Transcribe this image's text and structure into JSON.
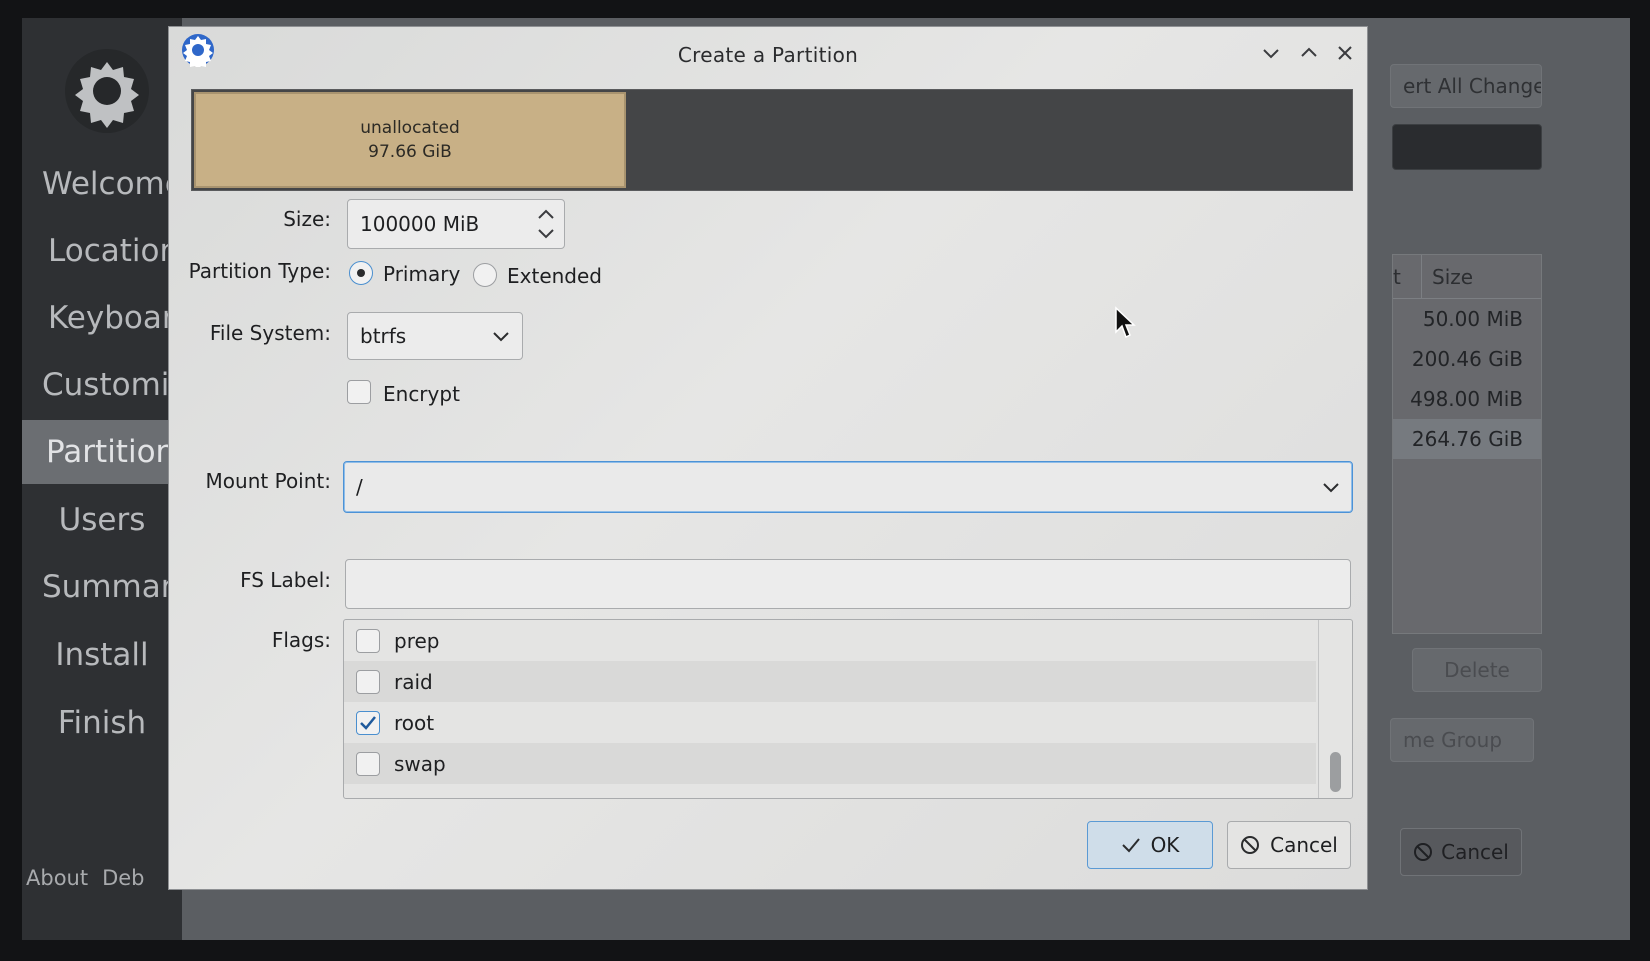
{
  "sidebar": {
    "items": [
      {
        "label": "Welcome"
      },
      {
        "label": "Location"
      },
      {
        "label": "Keyboard"
      },
      {
        "label": "Customize"
      },
      {
        "label": "Partitions"
      },
      {
        "label": "Users"
      },
      {
        "label": "Summary"
      },
      {
        "label": "Install"
      },
      {
        "label": "Finish"
      }
    ],
    "footer": {
      "about": "About",
      "debug": "Deb"
    }
  },
  "background": {
    "revert_label": "ert All Changes",
    "table_header_col1": "t",
    "table_header_col2": "Size",
    "rows": [
      {
        "size": "50.00 MiB"
      },
      {
        "size": "200.46 GiB"
      },
      {
        "size": "498.00 MiB"
      },
      {
        "size": "264.76 GiB"
      }
    ],
    "delete_label": "Delete",
    "volume_group_label": "me Group",
    "cancel_label": "Cancel"
  },
  "dialog": {
    "title": "Create a Partition",
    "partition_bar": {
      "segment_name": "unallocated",
      "segment_size": "97.66 GiB"
    },
    "size": {
      "label": "Size:",
      "value": "100000 MiB"
    },
    "partition_type": {
      "label": "Partition Type:",
      "primary": "Primary",
      "extended": "Extended",
      "selected": "Primary"
    },
    "file_system": {
      "label": "File System:",
      "value": "btrfs"
    },
    "encrypt": {
      "label": "Encrypt",
      "checked": false
    },
    "mount_point": {
      "label": "Mount Point:",
      "value": "/"
    },
    "fs_label": {
      "label": "FS Label:",
      "value": ""
    },
    "flags": {
      "label": "Flags:",
      "items": [
        {
          "name": "prep",
          "checked": false
        },
        {
          "name": "raid",
          "checked": false
        },
        {
          "name": "root",
          "checked": true
        },
        {
          "name": "swap",
          "checked": false
        }
      ]
    },
    "ok_label": "OK",
    "cancel_label": "Cancel"
  },
  "colors": {
    "accent": "#4c92d6",
    "unallocated": "#c8b086"
  }
}
